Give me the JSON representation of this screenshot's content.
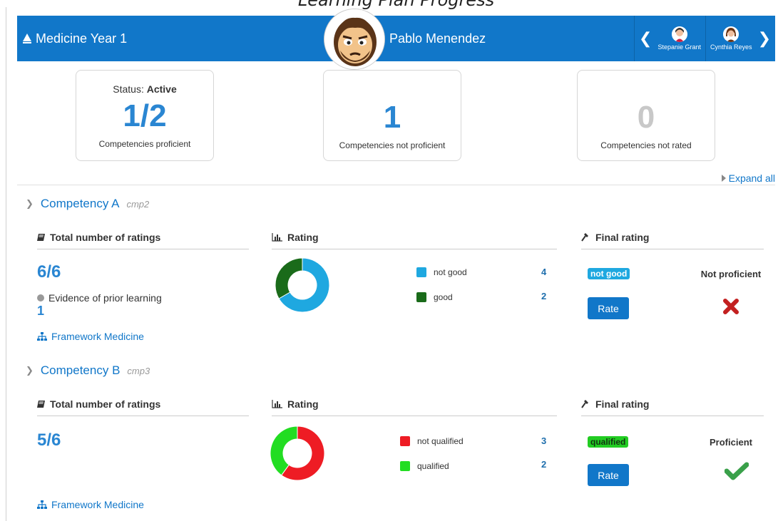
{
  "header": {
    "caption": "Learning Plan Progress",
    "plan_title": "Medicine Year 1",
    "user_name": "Pablo Menendez",
    "prev_user": "Stepanie Grant",
    "next_user": "Cynthia Reyes",
    "colors": {
      "bar": "#1177c9"
    }
  },
  "stats": {
    "status_label": "Status: ",
    "status_value": "Active",
    "proficient": {
      "value": "1/2",
      "caption": "Competencies proficient",
      "color": "#2a86d2"
    },
    "not_proficient": {
      "value": "1",
      "caption": "Competencies not proficient",
      "color": "#2a86d2"
    },
    "not_rated": {
      "value": "0",
      "caption": "Competencies not rated",
      "color": "#c8c8c8"
    }
  },
  "expand_all": "Expand all",
  "competencies": [
    {
      "name": "Competency A",
      "id": "cmp2",
      "total_title": "Total number of ratings",
      "total": "6/6",
      "evidence_label": "Evidence of prior learning",
      "evidence_count": "1",
      "framework": "Framework Medicine",
      "rating_title": "Rating",
      "final_title": "Final rating",
      "legend": [
        {
          "label": "not good",
          "count": "4",
          "color": "#1fa8e0"
        },
        {
          "label": "good",
          "count": "2",
          "color": "#1a6b1a"
        }
      ],
      "badge": "not good",
      "badge_color": "#1fa8e0",
      "rate_label": "Rate",
      "result": "Not proficient",
      "result_icon": "cross-icon"
    },
    {
      "name": "Competency B",
      "id": "cmp3",
      "total_title": "Total number of ratings",
      "total": "5/6",
      "framework": "Framework Medicine",
      "rating_title": "Rating",
      "final_title": "Final rating",
      "legend": [
        {
          "label": "not qualified",
          "count": "3",
          "color": "#ee1c24"
        },
        {
          "label": "qualified",
          "count": "2",
          "color": "#22dd22"
        }
      ],
      "badge": "qualified",
      "badge_color": "#22cc22",
      "rate_label": "Rate",
      "result": "Proficient",
      "result_icon": "check-icon"
    }
  ]
}
